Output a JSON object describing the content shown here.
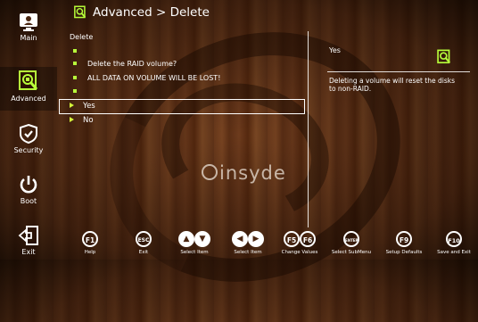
{
  "header": {
    "breadcrumb": "Advanced > Delete"
  },
  "sidebar": {
    "items": [
      {
        "label": "Main",
        "icon": "monitor-icon"
      },
      {
        "label": "Advanced",
        "icon": "advanced-icon"
      },
      {
        "label": "Security",
        "icon": "shield-icon"
      },
      {
        "label": "Boot",
        "icon": "power-icon"
      },
      {
        "label": "Exit",
        "icon": "exit-icon"
      }
    ],
    "active": "Advanced"
  },
  "menu": {
    "title": "Delete",
    "lines": [
      "",
      "Delete the RAID volume?",
      "ALL DATA ON VOLUME WILL BE LOST!",
      ""
    ],
    "options": [
      "Yes",
      "No"
    ],
    "selected": "Yes"
  },
  "help": {
    "heading": "Yes",
    "text": "Deleting a volume will reset the disks to non-RAID."
  },
  "brand": {
    "logo": "insyde"
  },
  "footer": {
    "keys": [
      {
        "keys": [
          "F1"
        ],
        "label": "Help"
      },
      {
        "keys": [
          "ESC"
        ],
        "label": "Exit"
      },
      {
        "keys": [
          "▲",
          "▼"
        ],
        "label": "Select Item"
      },
      {
        "keys": [
          "◀",
          "▶"
        ],
        "label": "Select Item"
      },
      {
        "keys": [
          "F5",
          "F6"
        ],
        "label": "Change Values"
      },
      {
        "keys": [
          "ENTER"
        ],
        "label": "Select SubMenu"
      },
      {
        "keys": [
          "F9"
        ],
        "label": "Setup Defaults"
      },
      {
        "keys": [
          "F10"
        ],
        "label": "Save and Exit"
      }
    ]
  },
  "colors": {
    "accent": "#b7ff3a",
    "text": "#ffffff",
    "background": "#6b3a1c"
  }
}
